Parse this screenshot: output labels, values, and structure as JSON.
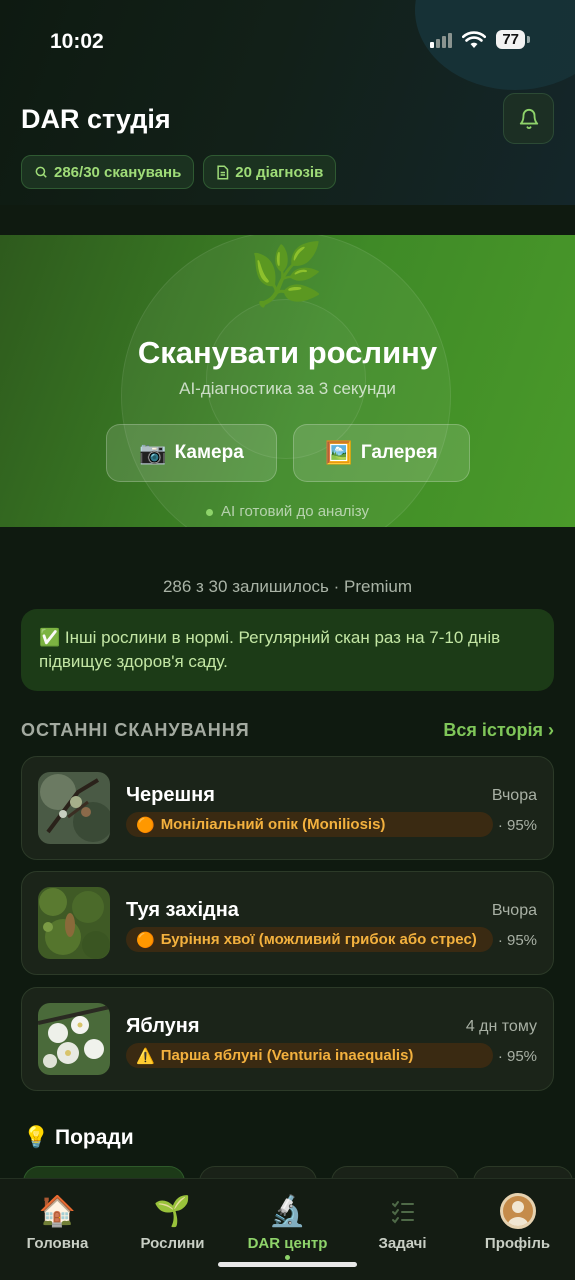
{
  "status_bar": {
    "time": "10:02",
    "battery": "77"
  },
  "header": {
    "title": "DAR студія",
    "chips": [
      {
        "icon": "search-icon",
        "label": "286/30 сканувань"
      },
      {
        "icon": "document-icon",
        "label": "20 діагнозів"
      }
    ]
  },
  "hero": {
    "title": "Сканувати рослину",
    "subtitle": "AI-діагностика за 3 секунди",
    "camera_label": "Камера",
    "gallery_label": "Галерея",
    "status": "AI готовий до аналізу"
  },
  "quota_text": "286 з 30 залишилось · Premium",
  "notice": "✅ Інші рослини в нормі. Регулярний скан раз на 7-10 днів підвищує здоров'я саду.",
  "recent": {
    "title": "ОСТАННІ СКАНУВАННЯ",
    "link": "Вся історія ›",
    "items": [
      {
        "name": "Черешня",
        "time": "Вчора",
        "diagnosis": "Моніліальний опік (Moniliosis)",
        "severity_icon": "🟠",
        "confidence": "· 95%"
      },
      {
        "name": "Туя західна",
        "time": "Вчора",
        "diagnosis": "Буріння хвої (можливий грибок або стрес)",
        "severity_icon": "🟠",
        "confidence": "· 95%"
      },
      {
        "name": "Яблуня",
        "time": "4 дн тому",
        "diagnosis": "Парша яблуні (Venturia inaequalis)",
        "severity_icon": "⚠️",
        "confidence": "· 95%"
      }
    ]
  },
  "tips": {
    "title": "💡 Поради"
  },
  "nav": [
    {
      "label": "Головна",
      "icon": "house-icon"
    },
    {
      "label": "Рослини",
      "icon": "sprout-icon"
    },
    {
      "label": "DAR центр",
      "icon": "microscope-icon",
      "active": true
    },
    {
      "label": "Задачі",
      "icon": "checklist-icon"
    },
    {
      "label": "Профіль",
      "icon": "avatar-icon"
    }
  ],
  "colors": {
    "accent": "#7fc659",
    "hero": "#3f8a27",
    "warning": "#f3b13e"
  }
}
